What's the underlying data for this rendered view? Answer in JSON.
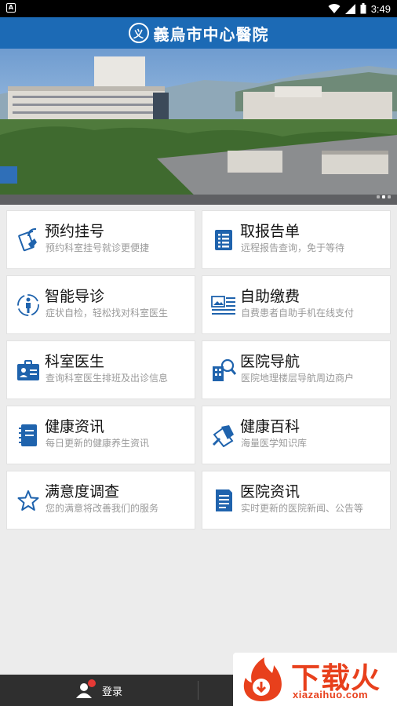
{
  "status_bar": {
    "time": "3:49",
    "left_icon": "A"
  },
  "header": {
    "title": "義烏市中心醫院",
    "logo_glyph": "义"
  },
  "banner": {
    "slides": 3,
    "active_slide": 2
  },
  "services": [
    {
      "title": "预约挂号",
      "subtitle": "预约科室挂号就诊更便捷",
      "icon": "phone-hand-icon"
    },
    {
      "title": "取报告单",
      "subtitle": "远程报告查询，免于等待",
      "icon": "document-icon"
    },
    {
      "title": "智能导诊",
      "subtitle": "症状自检，轻松找对科室医生",
      "icon": "body-guide-icon"
    },
    {
      "title": "自助缴费",
      "subtitle": "自费患者自助手机在线支付",
      "icon": "payment-card-icon"
    },
    {
      "title": "科室医生",
      "subtitle": "查询科室医生排班及出诊信息",
      "icon": "doctor-badge-icon"
    },
    {
      "title": "医院导航",
      "subtitle": "医院地理楼层导航周边商户",
      "icon": "building-search-icon"
    },
    {
      "title": "健康资讯",
      "subtitle": "每日更新的健康养生资讯",
      "icon": "notebook-icon"
    },
    {
      "title": "健康百科",
      "subtitle": "海量医学知识库",
      "icon": "pen-paper-icon"
    },
    {
      "title": "满意度调查",
      "subtitle": "您的满意将改善我们的服务",
      "icon": "star-icon"
    },
    {
      "title": "医院资讯",
      "subtitle": "实时更新的医院新闻、公告等",
      "icon": "news-icon"
    }
  ],
  "bottom_bar": {
    "login_label": "登录"
  },
  "watermark": {
    "text": "下载火",
    "domain": "xiazaihuo.com"
  },
  "colors": {
    "brand": "#1c6ab5",
    "icon_blue": "#1f63ad",
    "watermark": "#e8401c"
  }
}
